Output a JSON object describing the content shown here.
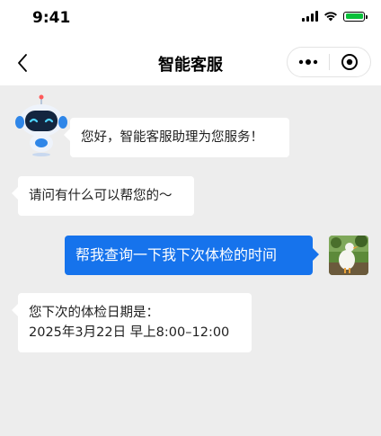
{
  "status_bar": {
    "time": "9:41",
    "battery_color": "#09c03a"
  },
  "nav": {
    "title": "智能客服",
    "back_icon": "chevron-left-icon",
    "more_icon": "more-dots-icon",
    "close_icon": "target-icon"
  },
  "messages": [
    {
      "sender": "bot",
      "text": "您好，智能客服助理为您服务！"
    },
    {
      "sender": "bot",
      "text": "请问有什么可以帮您的～"
    },
    {
      "sender": "user",
      "text": "帮我查询一下我下次体检的时间"
    },
    {
      "sender": "bot",
      "lines": [
        "您下次的体检日期是：",
        "2025年3月22日  早上8:00–12:00"
      ]
    }
  ],
  "colors": {
    "user_bubble": "#1673ec",
    "chat_background": "#ededed",
    "header_background": "#ffffff"
  }
}
